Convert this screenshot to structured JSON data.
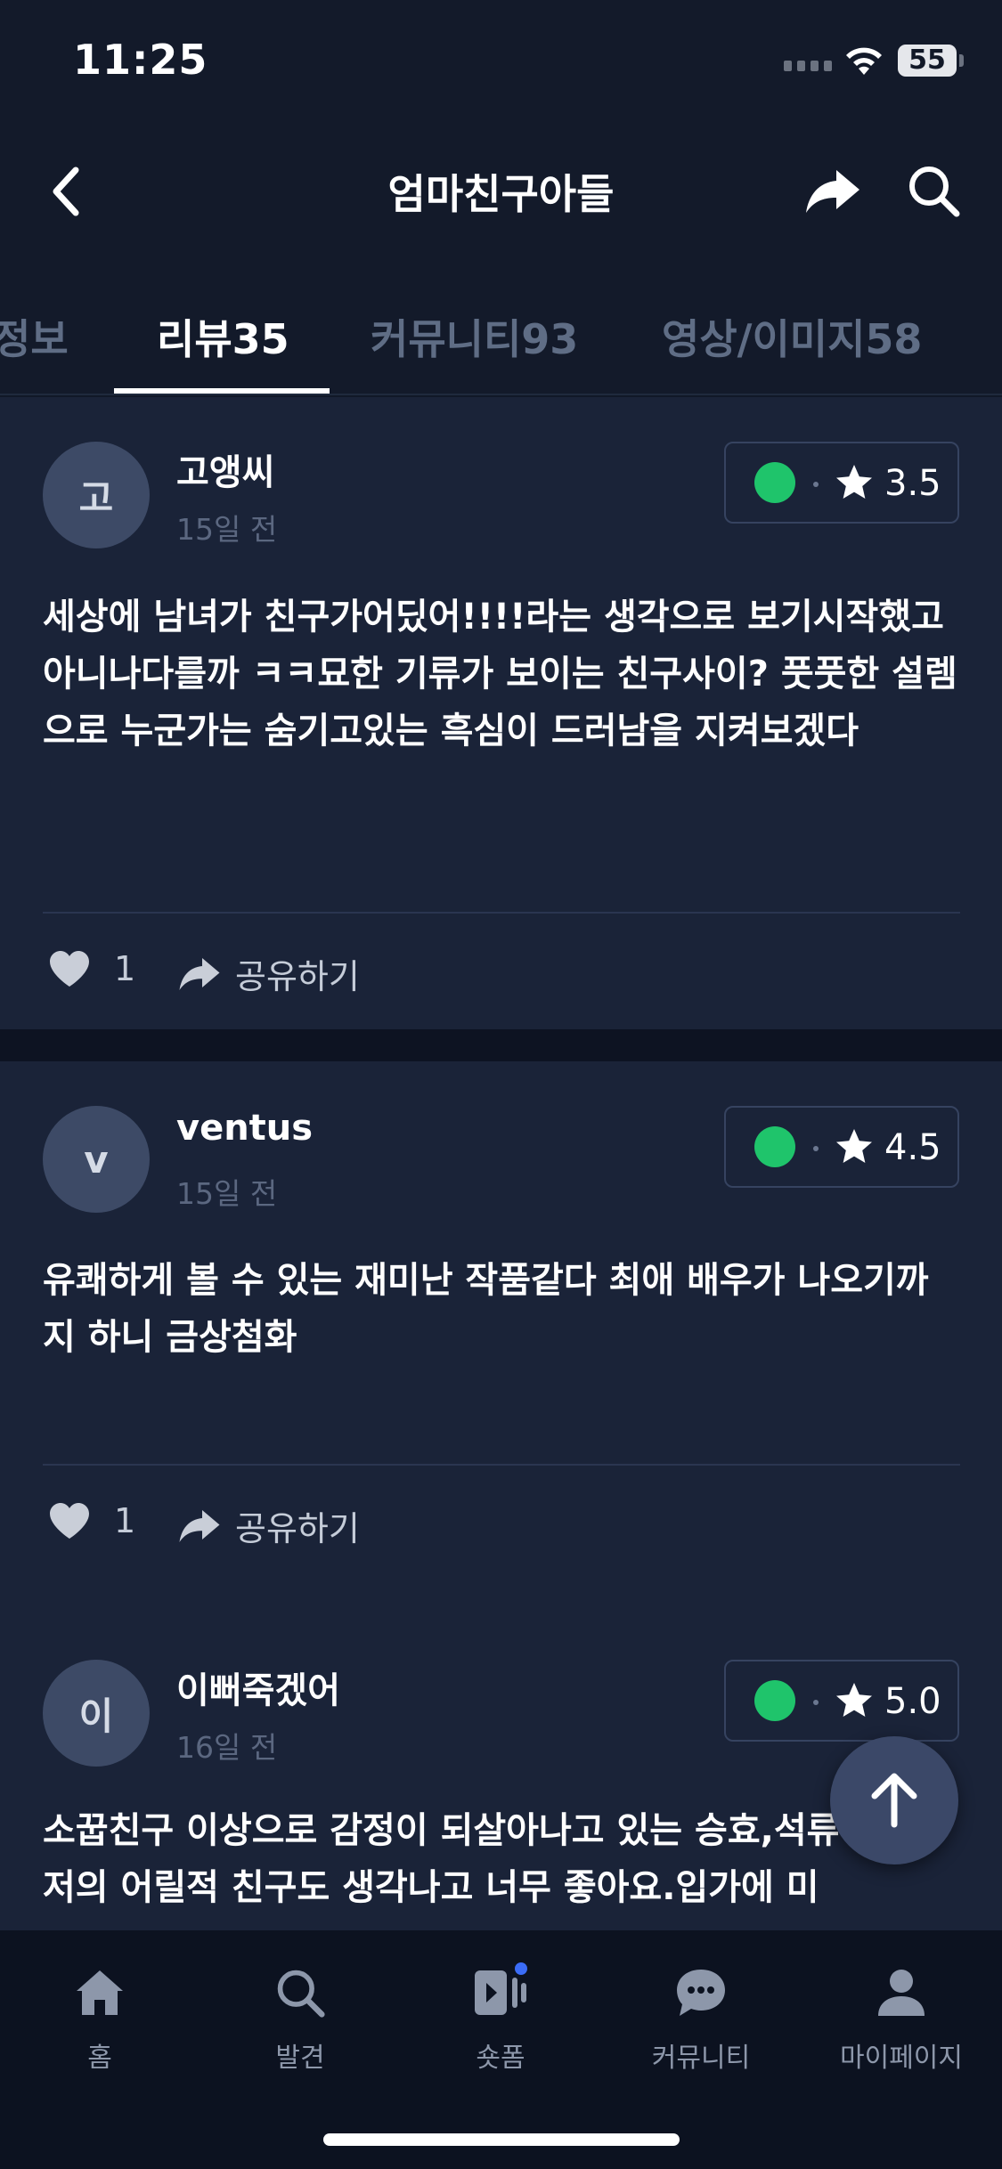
{
  "status_bar": {
    "time": "11:25",
    "battery": "55"
  },
  "header": {
    "title": "엄마친구아들"
  },
  "tabs": [
    {
      "label": "정보"
    },
    {
      "label": "리뷰35"
    },
    {
      "label": "커뮤니티93"
    },
    {
      "label": "영상/이미지58"
    }
  ],
  "reviews": [
    {
      "avatar": "고",
      "username": "고앵씨",
      "time": "15일 전",
      "rating": "3.5",
      "text": "세상에 남녀가 친구가어딨어!!!!라는 생각으로 보기시작했고 아니나다를까 ㅋㅋ묘한 기류가 보이는 친구사이? 풋풋한 설렘으로 누군가는 숨기고있는 흑심이 드러남을 지켜보겠다",
      "likes": "1",
      "share_label": "공유하기"
    },
    {
      "avatar": "v",
      "username": "ventus",
      "time": "15일 전",
      "rating": "4.5",
      "text": "유쾌하게 볼 수 있는 재미난 작품같다 최애 배우가 나오기까지 하니 금상첨화",
      "likes": "1",
      "share_label": "공유하기"
    },
    {
      "avatar": "이",
      "username": "이뻐죽겠어",
      "time": "16일 전",
      "rating": "5.0",
      "text": "소꿉친구 이상으로 감정이 되살아나고 있는 승효,석류 보니 저의 어릴적 친구도 생각나고 너무 좋아요.입가에 미",
      "likes": "",
      "share_label": ""
    }
  ],
  "bottom_nav": [
    {
      "label": "홈",
      "icon": "home-icon"
    },
    {
      "label": "발견",
      "icon": "search-icon"
    },
    {
      "label": "숏폼",
      "icon": "shortform-icon"
    },
    {
      "label": "커뮤니티",
      "icon": "chat-bubble-icon"
    },
    {
      "label": "마이페이지",
      "icon": "person-icon"
    }
  ],
  "colors": {
    "background": "#111827",
    "card": "#1a2338",
    "rating_dot": "#1fc46b",
    "nav_badge": "#3b6cf6",
    "muted_text": "#5b6780"
  }
}
